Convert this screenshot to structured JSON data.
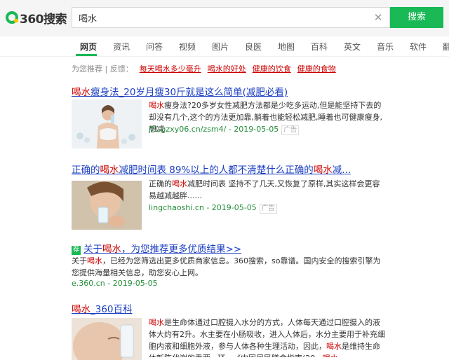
{
  "header": {
    "logo_text": "360搜索",
    "search_value": "喝水",
    "search_button": "搜索"
  },
  "tabs": [
    "网页",
    "资讯",
    "问答",
    "视频",
    "图片",
    "良医",
    "地图",
    "百科",
    "英文",
    "音乐",
    "软件",
    "翻"
  ],
  "active_tab": "网页",
  "recommend": {
    "label": "为您推荐 | 反馈：",
    "links": [
      "每天喝水多少毫升",
      "喝水的好处",
      "健康的饮食",
      "健康的食物"
    ]
  },
  "results": [
    {
      "title_pre": "",
      "title_hl": "喝水",
      "title_post": "瘦身法_20岁月瘦30斤就是这么简单(减肥必看)",
      "snippet_hl": "喝水",
      "snippet": "瘦身法?20多岁女性减肥方法都是少吃多运动,但是能坚持下去的却没有几个,这个的方法更加靠,躺着也能轻松减肥,睡着也可健康瘦身,想减",
      "url": "jf1.gzxy06.cn/zsm4/ - 2019-05-05",
      "badge": "广告"
    },
    {
      "title_pre": "正确的",
      "title_hl": "喝水",
      "title_mid": "减肥时间表 89%以上的人都不清楚什么正确的",
      "title_hl2": "喝水",
      "title_post": "减...",
      "snippet_pre": "正确的",
      "snippet_hl": "喝水",
      "snippet": "减肥时间表 坚持不了几天,又恢复了原样,其实这样会更容易越减越胖......",
      "url": "lingchaoshi.cn - 2019-05-05",
      "badge": "广告"
    },
    {
      "badge_icon": "荐",
      "title_pre": "关于",
      "title_hl": "喝水",
      "title_post": "，为您推荐更多优质结果>>",
      "snippet_pre": "关于",
      "snippet_hl": "喝水",
      "snippet": "，已经为您筛选出更多优质商家信息。360搜索，so靠谱。国内安全的搜索引擎为您提供海量相关信息，助您安心上网。",
      "url": "e.360.cn - 2019-05-05"
    },
    {
      "title_hl": "喝水",
      "title_post": "_360百科",
      "snippet_hl": "喝水",
      "snippet_a": "是生命体通过口腔摄入水分的方式，人体每天通过口腔摄入的液体大约有2升。水主要在小肠吸收，进入人体后，水分主要用于补充细胞内液和细胞外液，参与人体各种生理活动，因此，",
      "snippet_hl2": "喝水",
      "snippet_b": "是维持生命体新陈代谢的重要...环...《中国居民膳食指南(20...",
      "snippet_hl3": "喝水"
    }
  ]
}
